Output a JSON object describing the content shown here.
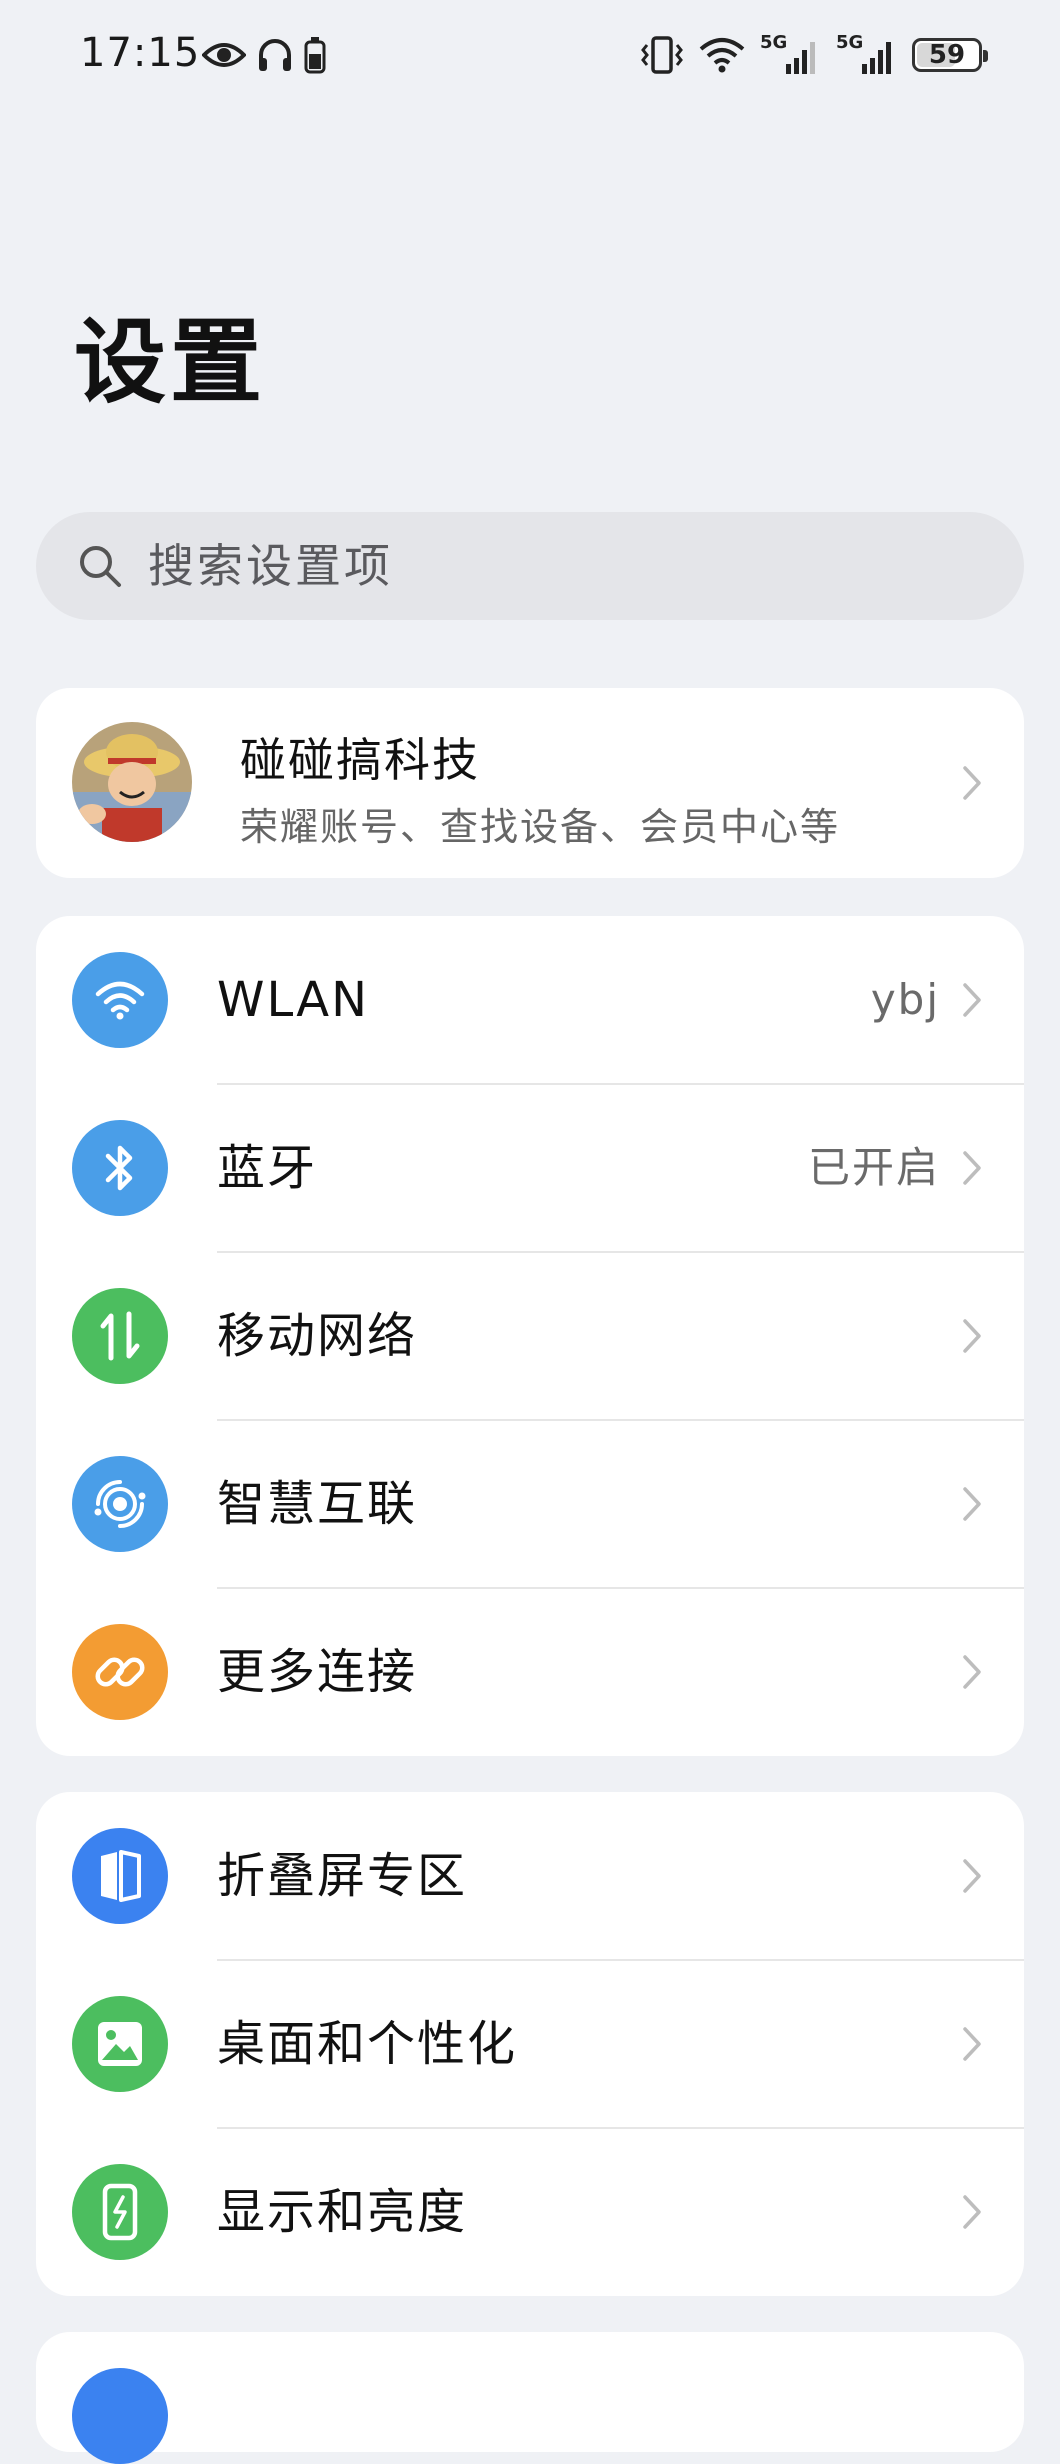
{
  "status_bar": {
    "time": "17:15",
    "battery": "59",
    "network_1": "5G",
    "network_2": "5G",
    "icons": [
      "eye-icon",
      "headphones-icon",
      "battery-small-icon",
      "vibrate-icon",
      "wifi-icon",
      "signal-icon",
      "signal-icon",
      "battery-icon"
    ]
  },
  "page_title": "设置",
  "search": {
    "placeholder": "搜索设置项"
  },
  "account": {
    "name": "碰碰搞科技",
    "subtitle": "荣耀账号、查找设备、会员中心等"
  },
  "groups": [
    {
      "items": [
        {
          "label": "WLAN",
          "value": "ybj",
          "icon": "wifi-icon",
          "color": "#4a9ee8"
        },
        {
          "label": "蓝牙",
          "value": "已开启",
          "icon": "bluetooth-icon",
          "color": "#4a9ee8"
        },
        {
          "label": "移动网络",
          "value": "",
          "icon": "mobile-data-icon",
          "color": "#4cbe5f"
        },
        {
          "label": "智慧互联",
          "value": "",
          "icon": "smart-connect-icon",
          "color": "#4a9ee8"
        },
        {
          "label": "更多连接",
          "value": "",
          "icon": "link-icon",
          "color": "#f39c33"
        }
      ]
    },
    {
      "items": [
        {
          "label": "折叠屏专区",
          "value": "",
          "icon": "foldable-icon",
          "color": "#3b82f0"
        },
        {
          "label": "桌面和个性化",
          "value": "",
          "icon": "wallpaper-icon",
          "color": "#4cbe5f"
        },
        {
          "label": "显示和亮度",
          "value": "",
          "icon": "display-icon",
          "color": "#4cbe5f"
        }
      ]
    }
  ]
}
